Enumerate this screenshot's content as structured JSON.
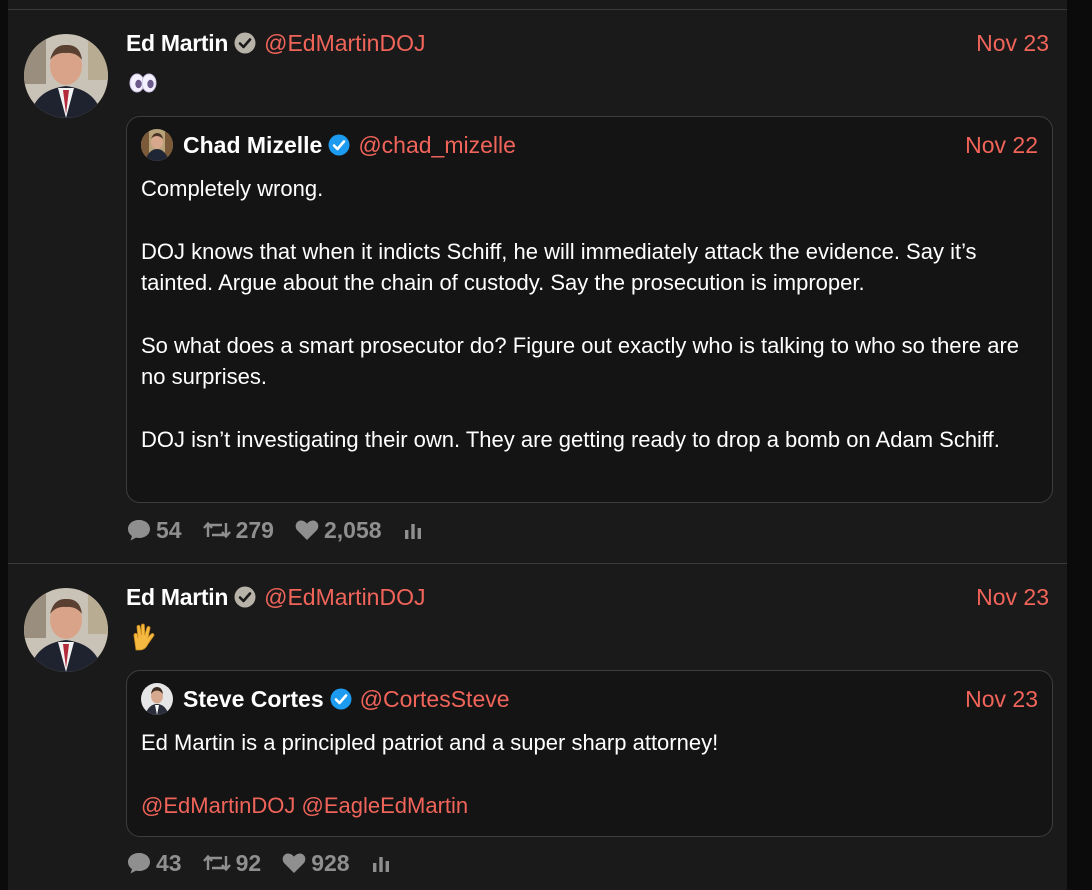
{
  "tweets": [
    {
      "author_name": "Ed Martin",
      "author_handle": "@EdMartinDOJ",
      "date": "Nov 23",
      "emoji_icon": "eyes-emoji-icon",
      "quote": {
        "author_name": "Chad Mizelle",
        "author_handle": "@chad_mizelle",
        "date": "Nov 22",
        "paragraphs": [
          "Completely wrong.",
          "DOJ knows that when it indicts Schiff, he will immediately attack the evidence. Say it’s tainted. Argue about the chain of custody. Say the prosecution is improper.",
          "So what does a smart prosecutor do?  Figure out exactly who is talking to who so there are no surprises.",
          "DOJ isn’t investigating their own. They are getting ready to drop a bomb on Adam Schiff."
        ]
      },
      "stats": {
        "replies": "54",
        "retweets": "279",
        "likes": "2,058"
      }
    },
    {
      "author_name": "Ed Martin",
      "author_handle": "@EdMartinDOJ",
      "date": "Nov 23",
      "emoji_icon": "vulcan-salute-emoji-icon",
      "quote": {
        "author_name": "Steve Cortes",
        "author_handle": "@CortesSteve",
        "date": "Nov 23",
        "text": "Ed Martin is a principled patriot and a super sharp attorney!",
        "mentions": [
          "@EdMartinDOJ",
          "@EagleEdMartin"
        ]
      },
      "stats": {
        "replies": "43",
        "retweets": "92",
        "likes": "928"
      }
    }
  ],
  "colors": {
    "accent": "#f0645a",
    "muted": "#8f8f8f",
    "verified_blue": "#1d9bf0",
    "gov_badge_gray": "#b8b3a8"
  }
}
